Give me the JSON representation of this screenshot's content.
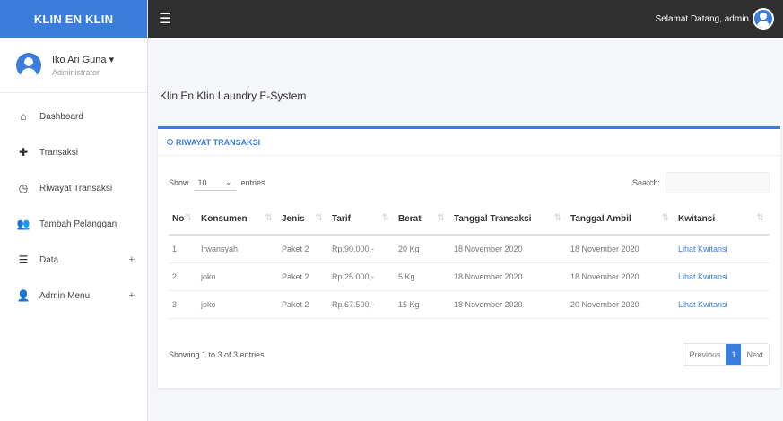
{
  "brand": "KLIN EN KLIN",
  "user": {
    "name": "Iko Ari Guna",
    "caret": "▾",
    "role": "Administrator"
  },
  "nav": [
    {
      "icon": "home-icon",
      "glyph": "⌂",
      "label": "Dashboard",
      "plus": ""
    },
    {
      "icon": "plus-icon",
      "glyph": "✚",
      "label": "Transaksi",
      "plus": ""
    },
    {
      "icon": "history-icon",
      "glyph": "◷",
      "label": "Riwayat Transaksi",
      "plus": ""
    },
    {
      "icon": "add-user-icon",
      "glyph": "👥",
      "label": "Tambah Pelanggan",
      "plus": ""
    },
    {
      "icon": "data-icon",
      "glyph": "☰",
      "label": "Data",
      "plus": "+"
    },
    {
      "icon": "admin-icon",
      "glyph": "👤",
      "label": "Admin Menu",
      "plus": "+"
    }
  ],
  "topbar": {
    "menu_glyph": "☰",
    "greeting": "Selamat Datang, admin"
  },
  "page_title": "Klin En Klin Laundry E-System",
  "card": {
    "title": "RIWAYAT TRANSAKSI",
    "show_label": "Show",
    "entries_value": "10",
    "entries_label": "entries",
    "search_label": "Search:",
    "columns": [
      "No",
      "Konsumen",
      "Jenis",
      "Tarif",
      "Berat",
      "Tanggal Transaksi",
      "Tanggal Ambil",
      "Kwitansi"
    ],
    "rows": [
      [
        "1",
        "Irwansyah",
        "Paket 2",
        "Rp.90.000,-",
        "20 Kg",
        "18 November 2020",
        "18 November 2020",
        "Lihat Kwitansi"
      ],
      [
        "2",
        "joko",
        "Paket 2",
        "Rp.25.000,-",
        "5 Kg",
        "18 November 2020",
        "18 November 2020",
        "Lihat Kwitansi"
      ],
      [
        "3",
        "joko",
        "Paket 2",
        "Rp.67.500,-",
        "15 Kg",
        "18 November 2020",
        "20 November 2020",
        "Lihat Kwitansi"
      ]
    ],
    "info": "Showing 1 to 3 of 3 entries",
    "pager": {
      "previous": "Previous",
      "current": "1",
      "next": "Next"
    }
  },
  "colors": {
    "accent": "#3b7ddd",
    "topbar": "#2f2f2f"
  }
}
